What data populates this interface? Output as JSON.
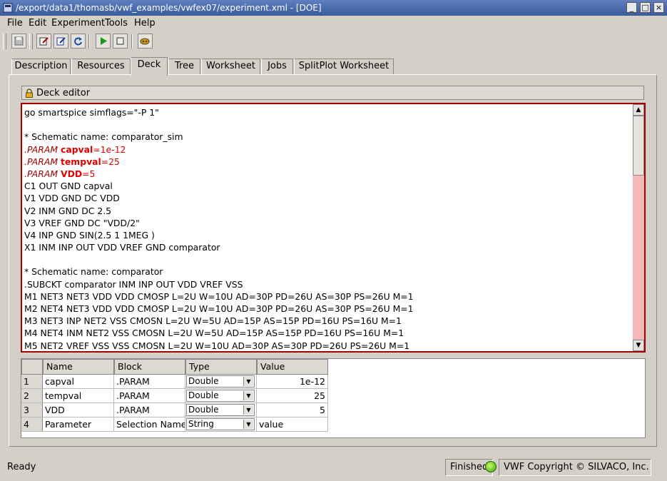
{
  "window": {
    "title": "/export/data1/thomasb/vwf_examples/vwfex07/experiment.xml - [DOE]",
    "app_icon": "app-icon",
    "controls": [
      "minimize-icon",
      "maximize-icon",
      "close-icon"
    ]
  },
  "menu": [
    "File",
    "Edit",
    "Experiment",
    "Tools",
    "Help"
  ],
  "toolbar": {
    "buttons": [
      "save-icon",
      "edit-icon",
      "edit2-icon",
      "refresh-icon",
      "run-icon",
      "stop-icon",
      "settings-icon"
    ]
  },
  "tabs": [
    "Description",
    "Resources",
    "Deck",
    "Tree",
    "Worksheet",
    "Jobs",
    "SplitPlot Worksheet"
  ],
  "active_tab": "Deck",
  "deck": {
    "header_label": "Deck editor",
    "line1": "go smartspice simflags=\"-P 1\"",
    "line3": "* Schematic name: comparator_sim",
    "param1": {
      "kw": ".PARAM ",
      "name": "capval",
      "eq": "=",
      "value": "1e-12"
    },
    "param2": {
      "kw": ".PARAM ",
      "name": "tempval",
      "eq": "=",
      "value": "25"
    },
    "param3": {
      "kw": ".PARAM ",
      "name": "VDD",
      "eq": "=",
      "value": "5"
    },
    "line7": "C1 OUT GND capval",
    "line8": "V1 VDD GND DC VDD",
    "line9": "V2 INM GND DC 2.5",
    "line10": "V3 VREF GND DC \"VDD/2\"",
    "line11": "V4 INP GND SIN(2.5 1 1MEG )",
    "line12": "X1 INM INP OUT VDD VREF GND comparator",
    "line14": "* Schematic name: comparator",
    "line15": ".SUBCKT comparator INM INP OUT VDD VREF VSS",
    "line16": "M1 NET3 NET3 VDD VDD CMOSP L=2U W=10U AD=30P PD=26U AS=30P PS=26U M=1",
    "line17": "M2 NET4 NET3 VDD VDD CMOSP L=2U W=10U AD=30P PD=26U AS=30P PS=26U M=1",
    "line18": "M3 NET3 INP NET2 VSS CMOSN L=2U W=5U AD=15P AS=15P PD=16U PS=16U M=1",
    "line19": "M4 NET4 INM NET2 VSS CMOSN L=2U W=5U AD=15P AS=15P PD=16U PS=16U M=1",
    "line20": "M5 NET2 VREF VSS VSS CMOSN L=2U W=10U AD=30P AS=30P PD=26U PS=26U M=1"
  },
  "param_table": {
    "columns": [
      "Name",
      "Block",
      "Type",
      "Value"
    ],
    "rows": [
      {
        "idx": "1",
        "name": "capval",
        "block": ".PARAM",
        "type": "Double",
        "value": "1e-12"
      },
      {
        "idx": "2",
        "name": "tempval",
        "block": ".PARAM",
        "type": "Double",
        "value": "25"
      },
      {
        "idx": "3",
        "name": "VDD",
        "block": ".PARAM",
        "type": "Double",
        "value": "5"
      },
      {
        "idx": "4",
        "name": "Parameter",
        "block": "Selection Name",
        "type": "String",
        "value": "value"
      }
    ]
  },
  "status": {
    "text": "Ready",
    "job_state": "Finished",
    "indicator_color": "#44b000",
    "copyright": "VWF Copyright ©  SILVACO, Inc."
  },
  "colors": {
    "titlebar": "#3a5c9c",
    "editor_border": "#a00000",
    "param_highlight": "#e00000",
    "scrollbar_track": "#f4b8b8"
  }
}
